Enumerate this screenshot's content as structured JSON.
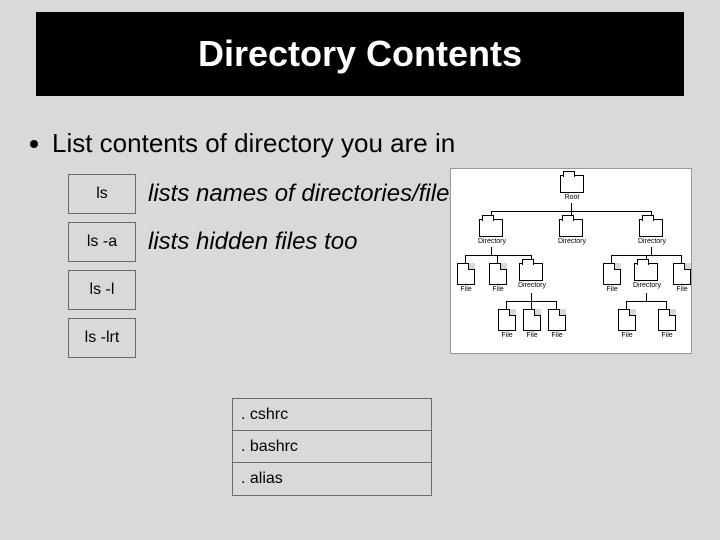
{
  "title": "Directory Contents",
  "bullet": "List contents of directory you are in",
  "commands": [
    {
      "cmd": "ls",
      "desc": "lists names of directories/files"
    },
    {
      "cmd": "ls  -a",
      "desc": "lists hidden files too"
    },
    {
      "cmd": "ls  -l",
      "desc": ""
    },
    {
      "cmd": "ls  -lrt",
      "desc": ""
    }
  ],
  "hidden_files": [
    ". cshrc",
    ". bashrc",
    ". alias"
  ],
  "tree": {
    "root": "Root",
    "level1": [
      "Directory",
      "Directory",
      "Directory"
    ],
    "level2_left": [
      "File",
      "File",
      "Directory"
    ],
    "level2_right": [
      "File",
      "Directory",
      "File"
    ],
    "level3": [
      "File",
      "File",
      "File",
      "File",
      "File"
    ]
  }
}
